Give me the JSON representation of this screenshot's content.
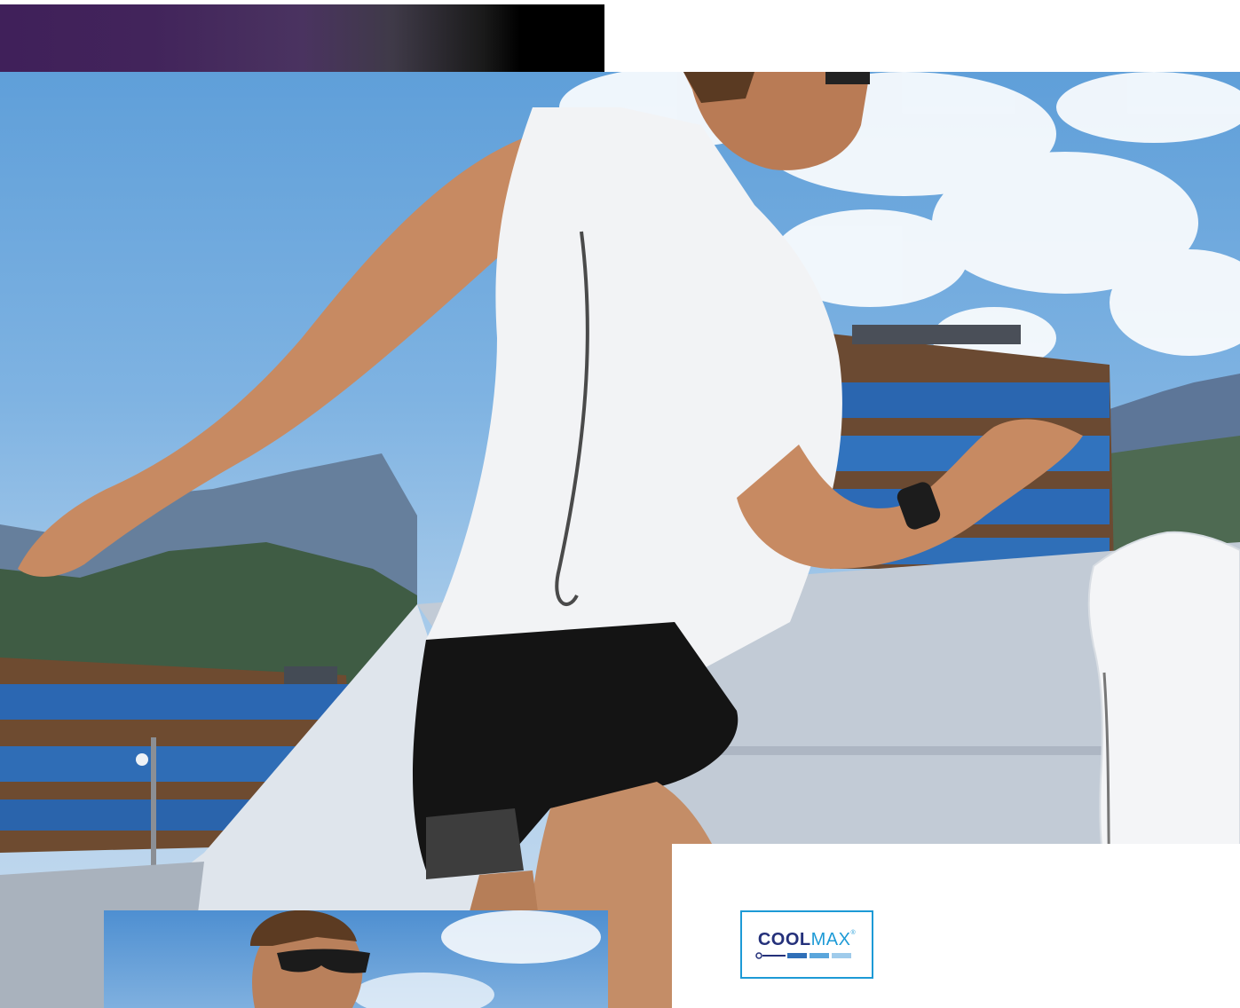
{
  "header": {
    "gradient_colors": [
      "#40205a",
      "#4a3360",
      "#000000"
    ]
  },
  "logo": {
    "brand_strong": "COOL",
    "brand_light": "MAX",
    "registered_mark": "®",
    "border_color": "#1d9ad6",
    "text_color": "#24307a"
  },
  "product": {
    "image_name": "white-sleeveless-running-shirt"
  },
  "scene": {
    "image_name": "runner-on-rooftop-with-mountains"
  },
  "inset": {
    "image_name": "runner-with-sunglasses"
  }
}
